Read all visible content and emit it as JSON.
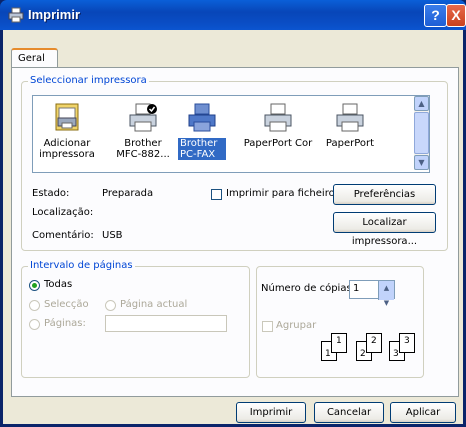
{
  "window": {
    "title": "Imprimir",
    "help_button": "?",
    "close_button": "X"
  },
  "tabs": [
    {
      "label": "Geral",
      "active": true
    }
  ],
  "printer_group": {
    "legend": "Seleccionar impressora",
    "printers": [
      {
        "label_line1": "Adicionar",
        "label_line2": "impressora",
        "icon": "add-printer-icon",
        "selected": false
      },
      {
        "label_line1": "Brother",
        "label_line2": "MFC-882...",
        "icon": "default-printer-icon",
        "selected": false
      },
      {
        "label_line1": "Brother",
        "label_line2": "PC-FAX",
        "icon": "printer-icon",
        "selected": true
      },
      {
        "label_line1": "PaperPort Cor",
        "label_line2": "",
        "icon": "printer-icon",
        "selected": false
      },
      {
        "label_line1": "PaperPort",
        "label_line2": "",
        "icon": "printer-icon",
        "selected": false
      }
    ],
    "status_label": "Estado:",
    "status_value": "Preparada",
    "location_label": "Localização:",
    "location_value": "",
    "comment_label": "Comentário:",
    "comment_value": "USB",
    "print_to_file_label": "Imprimir para ficheiro",
    "print_to_file_checked": false,
    "preferences_button": "Preferências",
    "find_printer_button": "Localizar impressora..."
  },
  "page_range": {
    "legend": "Intervalo de páginas",
    "all_label": "Todas",
    "selection_label": "Selecção",
    "current_page_label": "Página actual",
    "pages_label": "Páginas:",
    "pages_value": "",
    "selected_option": "all"
  },
  "copies": {
    "label": "Número de cópias:",
    "value": "1",
    "collate_label": "Agrupar",
    "collate_checked": false,
    "page_numbers": [
      "1",
      "1",
      "2",
      "2",
      "3",
      "3"
    ]
  },
  "footer": {
    "print_button": "Imprimir",
    "cancel_button": "Cancelar",
    "apply_button": "Aplicar"
  },
  "colors": {
    "title_bar": "#0a4ec6",
    "dialog_bg": "#ece9d8",
    "selection": "#316ac5",
    "group_legend": "#0046d5"
  }
}
